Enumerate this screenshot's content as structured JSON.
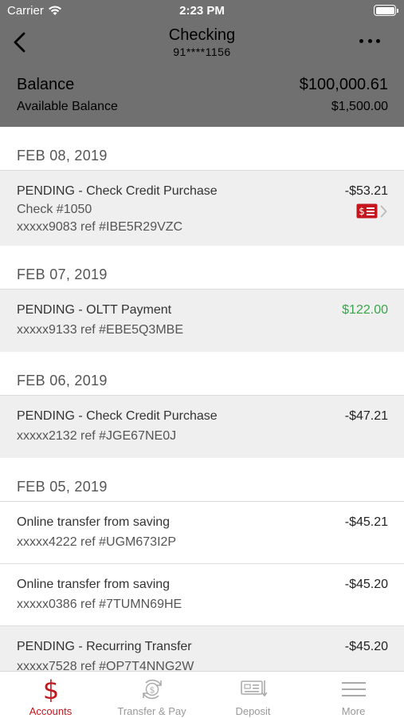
{
  "status": {
    "carrier": "Carrier",
    "time": "2:23 PM"
  },
  "header": {
    "title": "Checking",
    "account_number": "91****1156",
    "balance_label": "Balance",
    "balance_value": "$100,000.61",
    "available_label": "Available Balance",
    "available_value": "$1,500.00"
  },
  "groups": [
    {
      "date": "FEB 08, 2019",
      "transactions": [
        {
          "description": "PENDING - Check Credit Purchase",
          "line2": "Check #1050",
          "line3": "xxxxx9083 ref #IBE5R29VZC",
          "amount": "-$53.21"
        }
      ]
    },
    {
      "date": "FEB 07, 2019",
      "transactions": [
        {
          "description": "PENDING - OLTT Payment",
          "line2": "xxxxx9133 ref #EBE5Q3MBE",
          "amount": "$122.00"
        }
      ]
    },
    {
      "date": "FEB 06, 2019",
      "transactions": [
        {
          "description": "PENDING - Check Credit Purchase",
          "line2": "xxxxx2132 ref #JGE67NE0J",
          "amount": "-$47.21"
        }
      ]
    },
    {
      "date": "FEB 05, 2019",
      "transactions": [
        {
          "description": "Online transfer from saving",
          "line2": "xxxxx4222 ref #UGM673I2P",
          "amount": "-$45.21"
        },
        {
          "description": "Online transfer from saving",
          "line2": "xxxxx0386 ref #7TUMN69HE",
          "amount": "-$45.20"
        },
        {
          "description": "PENDING - Recurring Transfer",
          "line2": "xxxxx7528 ref #OP7T4NNG2W",
          "amount": "-$45.20"
        }
      ]
    }
  ],
  "tabs": [
    {
      "label": "Accounts",
      "icon": "dollar-icon"
    },
    {
      "label": "Transfer & Pay",
      "icon": "transfer-pay-icon"
    },
    {
      "label": "Deposit",
      "icon": "deposit-icon"
    },
    {
      "label": "More",
      "icon": "hamburger-icon"
    }
  ],
  "colors": {
    "accent": "#c4161c",
    "header_bg": "#707070",
    "positive": "#3aa54a",
    "pending_row": "#efefef"
  }
}
